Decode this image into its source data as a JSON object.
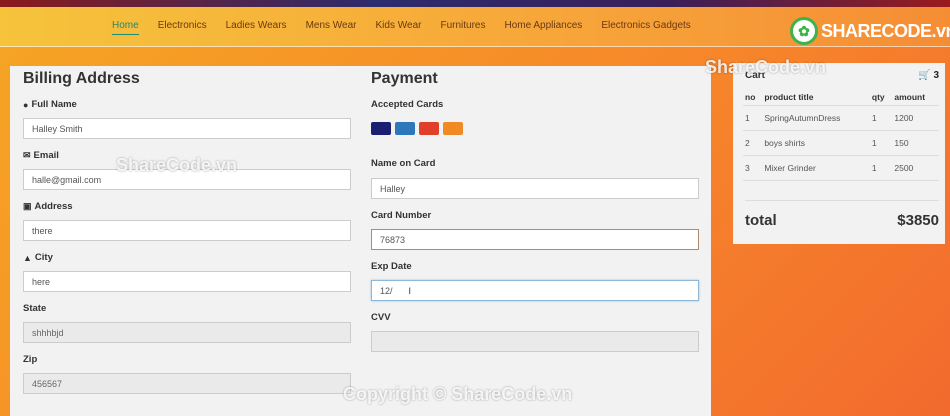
{
  "nav": {
    "items": [
      "Home",
      "Electronics",
      "Ladies Wears",
      "Mens Wear",
      "Kids Wear",
      "Furnitures",
      "Home Appliances",
      "Electronics Gadgets"
    ],
    "active": "Home"
  },
  "logo": {
    "text": "SHARECODE.vn"
  },
  "billing": {
    "title": "Billing Address",
    "full_name_label": "Full Name",
    "full_name_value": "Halley Smith",
    "email_label": "Email",
    "email_value": "halle@gmail.com",
    "address_label": "Address",
    "address_value": "there",
    "city_label": "City",
    "city_value": "here",
    "state_label": "State",
    "state_value": "shhhbjd",
    "zip_label": "Zip",
    "zip_value": "456567"
  },
  "payment": {
    "title": "Payment",
    "accepted_cards_label": "Accepted Cards",
    "cards": [
      {
        "name": "visa-icon",
        "color": "#1a1f71"
      },
      {
        "name": "amex-icon",
        "color": "#2e77bb"
      },
      {
        "name": "mastercard-icon",
        "color": "#e0402a"
      },
      {
        "name": "discover-icon",
        "color": "#f08a24"
      }
    ],
    "name_on_card_label": "Name on Card",
    "name_on_card_value": "Halley",
    "card_number_label": "Card Number",
    "card_number_value": "76873",
    "exp_date_label": "Exp Date",
    "exp_date_value": "12/",
    "cvv_label": "CVV",
    "cvv_value": ""
  },
  "cart": {
    "title": "Cart",
    "count": "3",
    "columns": [
      "no",
      "product title",
      "qty",
      "amount"
    ],
    "rows": [
      [
        "1",
        "SpringAutumnDress",
        "1",
        "1200"
      ],
      [
        "2",
        "boys shirts",
        "1",
        "150"
      ],
      [
        "3",
        "Mixer Grinder",
        "1",
        "2500"
      ]
    ],
    "total_label": "total",
    "total_value": "$3850"
  },
  "watermarks": {
    "top": "ShareCode.vn",
    "middle": "ShareCode.vn",
    "bottom": "Copyright © ShareCode.vn"
  }
}
